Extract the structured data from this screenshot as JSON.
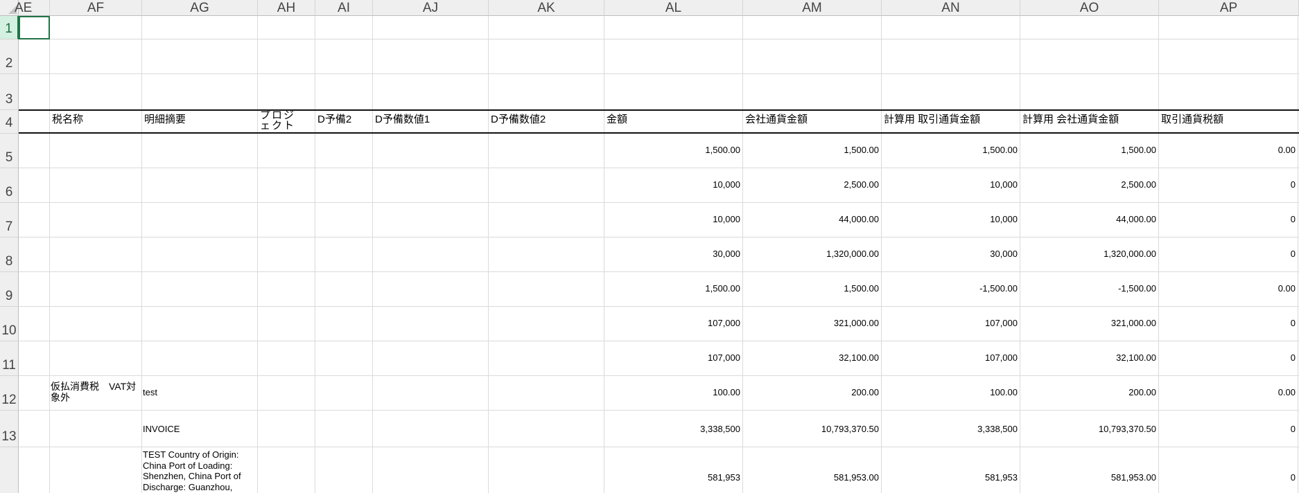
{
  "columns": [
    "AE",
    "AF",
    "AG",
    "AH",
    "AI",
    "AJ",
    "AK",
    "AL",
    "AM",
    "AN",
    "AO",
    "AP"
  ],
  "rows": [
    "1",
    "2",
    "3",
    "4",
    "5",
    "6",
    "7",
    "8",
    "9",
    "10",
    "11",
    "12",
    "13"
  ],
  "header_row": {
    "AF": "税名称",
    "AG": "明細摘要",
    "AH": "プロジェクト",
    "AI": "D予備2",
    "AJ": "D予備数値1",
    "AK": "D予備数値2",
    "AL": "金額",
    "AM": "会社通貨金額",
    "AN": "計算用 取引通貨金額",
    "AO": "計算用 会社通貨金額",
    "AP": "取引通貨税額"
  },
  "data_rows": [
    {
      "AF": "",
      "AG": "",
      "AL": "1,500.00",
      "AM": "1,500.00",
      "AN": "1,500.00",
      "AO": "1,500.00",
      "AP": "0.00"
    },
    {
      "AF": "",
      "AG": "",
      "AL": "10,000",
      "AM": "2,500.00",
      "AN": "10,000",
      "AO": "2,500.00",
      "AP": "0"
    },
    {
      "AF": "",
      "AG": "",
      "AL": "10,000",
      "AM": "44,000.00",
      "AN": "10,000",
      "AO": "44,000.00",
      "AP": "0"
    },
    {
      "AF": "",
      "AG": "",
      "AL": "30,000",
      "AM": "1,320,000.00",
      "AN": "30,000",
      "AO": "1,320,000.00",
      "AP": "0"
    },
    {
      "AF": "",
      "AG": "",
      "AL": "1,500.00",
      "AM": "1,500.00",
      "AN": "-1,500.00",
      "AO": "-1,500.00",
      "AP": "0.00"
    },
    {
      "AF": "",
      "AG": "",
      "AL": "107,000",
      "AM": "321,000.00",
      "AN": "107,000",
      "AO": "321,000.00",
      "AP": "0"
    },
    {
      "AF": "",
      "AG": "",
      "AL": "107,000",
      "AM": "32,100.00",
      "AN": "107,000",
      "AO": "32,100.00",
      "AP": "0"
    },
    {
      "AF": "仮払消費税　VAT対象外",
      "AG": "test",
      "AL": "100.00",
      "AM": "200.00",
      "AN": "100.00",
      "AO": "200.00",
      "AP": "0.00"
    },
    {
      "AF": "",
      "AG": "INVOICE",
      "AL": "3,338,500",
      "AM": "10,793,370.50",
      "AN": "3,338,500",
      "AO": "10,793,370.50",
      "AP": "0"
    },
    {
      "AF": "",
      "AG": "TEST Country of Origin: China  Port of Loading: Shenzhen, China  Port of Discharge: Guanzhou,",
      "AL": "581,953",
      "AM": "581,953.00",
      "AN": "581,953",
      "AO": "581,953.00",
      "AP": "0"
    }
  ],
  "selected_cell": "AE1",
  "colors": {
    "selection": "#217346",
    "header_bg": "#efefef",
    "grid": "#dadada"
  }
}
